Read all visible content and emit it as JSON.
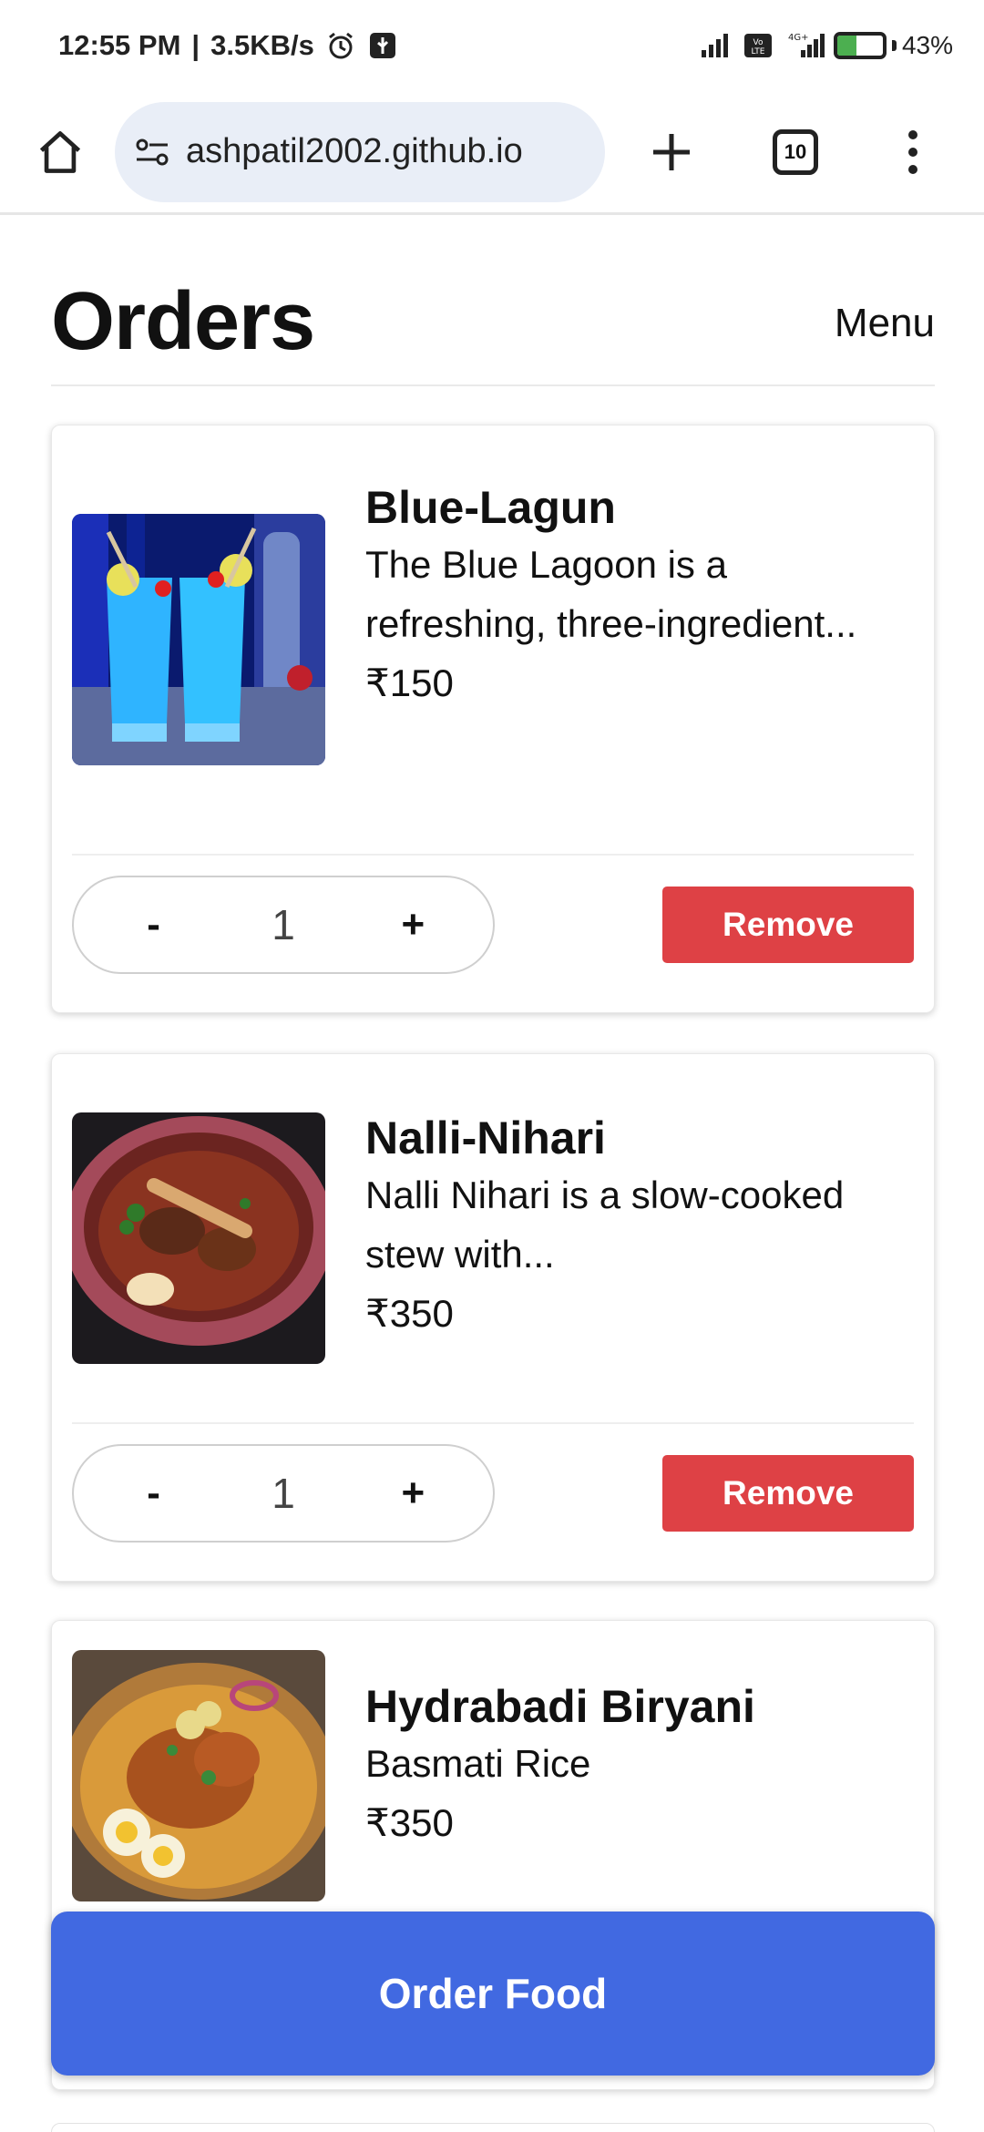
{
  "status_bar": {
    "time": "12:55 PM",
    "separator": "|",
    "speed": "3.5KB/s",
    "battery": "43%",
    "battery_level": 0.43,
    "network": "4G+",
    "volte": "VoLTE"
  },
  "browser": {
    "url": "ashpatil2002.github.io",
    "tab_count": "10",
    "icons": [
      "home-icon",
      "site-settings-icon",
      "new-tab-icon",
      "tab-switcher-icon",
      "more-options-icon"
    ]
  },
  "header": {
    "title": "Orders",
    "menu_label": "Menu"
  },
  "orders": [
    {
      "name": "Blue-Lagun",
      "description": "The Blue Lagoon is a refreshing, three-ingredient...",
      "price": "₹150",
      "quantity": "1",
      "minus": "-",
      "plus": "+",
      "remove_label": "Remove"
    },
    {
      "name": "Nalli-Nihari",
      "description": "Nalli Nihari is a slow-cooked stew with...",
      "price": "₹350",
      "quantity": "1",
      "minus": "-",
      "plus": "+",
      "remove_label": "Remove"
    },
    {
      "name": "Hydrabadi Biryani",
      "description": "Basmati Rice",
      "price": "₹350"
    }
  ],
  "order_button": "Order Food",
  "colors": {
    "remove": "#de4145",
    "order": "#4169e1",
    "url_bg": "#e9eef7"
  }
}
